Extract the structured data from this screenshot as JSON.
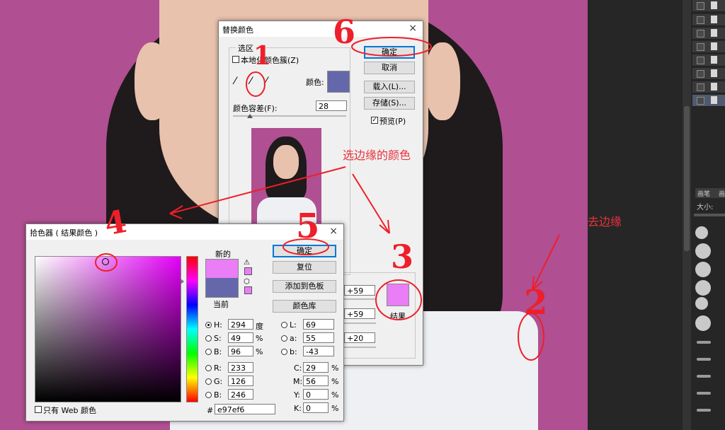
{
  "replace_dialog": {
    "title": "替换颜色",
    "close_glyph": "×",
    "group_label": "选区",
    "localized_label": "本地化颜色簇(Z)",
    "color_label": "颜色:",
    "tolerance_label": "颜色容差(F):",
    "tolerance_value": "28",
    "ok_label": "确定",
    "cancel_label": "取消",
    "load_label": "载入(L)...",
    "save_label": "存储(S)...",
    "preview_label": "预览(P)",
    "sample_color": "#6468aa",
    "hue_value": "+59",
    "saturation_value": "+59",
    "lightness_value": "+20",
    "result_label": "结果",
    "result_color": "#e97ef6"
  },
  "picker_dialog": {
    "title": "拾色器 ( 结果颜色 )",
    "close_glyph": "×",
    "new_label": "新的",
    "current_label": "当前",
    "new_color": "#e97ef6",
    "current_color": "#6468aa",
    "ok_label": "确定",
    "reset_label": "复位",
    "add_swatch_label": "添加到色板",
    "library_label": "颜色库",
    "web_only_label": "只有 Web 颜色",
    "hex_prefix": "#",
    "hex_value": "e97ef6",
    "fields": {
      "h_label": "H:",
      "h_value": "294",
      "h_unit": "度",
      "s_label": "S:",
      "s_value": "49",
      "s_unit": "%",
      "b_label": "B:",
      "b_value": "96",
      "b_unit": "%",
      "r_label": "R:",
      "r_value": "233",
      "g_label": "G:",
      "g_value": "126",
      "bl_label": "B:",
      "bl_value": "246",
      "l_label": "L:",
      "l_value": "69",
      "a_label": "a:",
      "a_value": "55",
      "b2_label": "b:",
      "b2_value": "-43",
      "c_label": "C:",
      "c_value": "29",
      "c_unit": "%",
      "m_label": "M:",
      "m_value": "56",
      "m_unit": "%",
      "y_label": "Y:",
      "y_value": "0",
      "y_unit": "%",
      "k_label": "K:",
      "k_value": "0",
      "k_unit": "%"
    }
  },
  "right_panel": {
    "tab_brush": "画笔",
    "tab_other": "画",
    "size_label": "大小:"
  },
  "annotations": {
    "pick_edge_color": "选边缘的颜色",
    "remove_edge": "去边缘",
    "num_1": "1",
    "num_2": "2",
    "num_3": "3",
    "num_4": "4",
    "num_5": "5",
    "num_6": "6"
  },
  "colors": {
    "background": "#b04f92",
    "annotation_red": "#ee1f2a"
  }
}
